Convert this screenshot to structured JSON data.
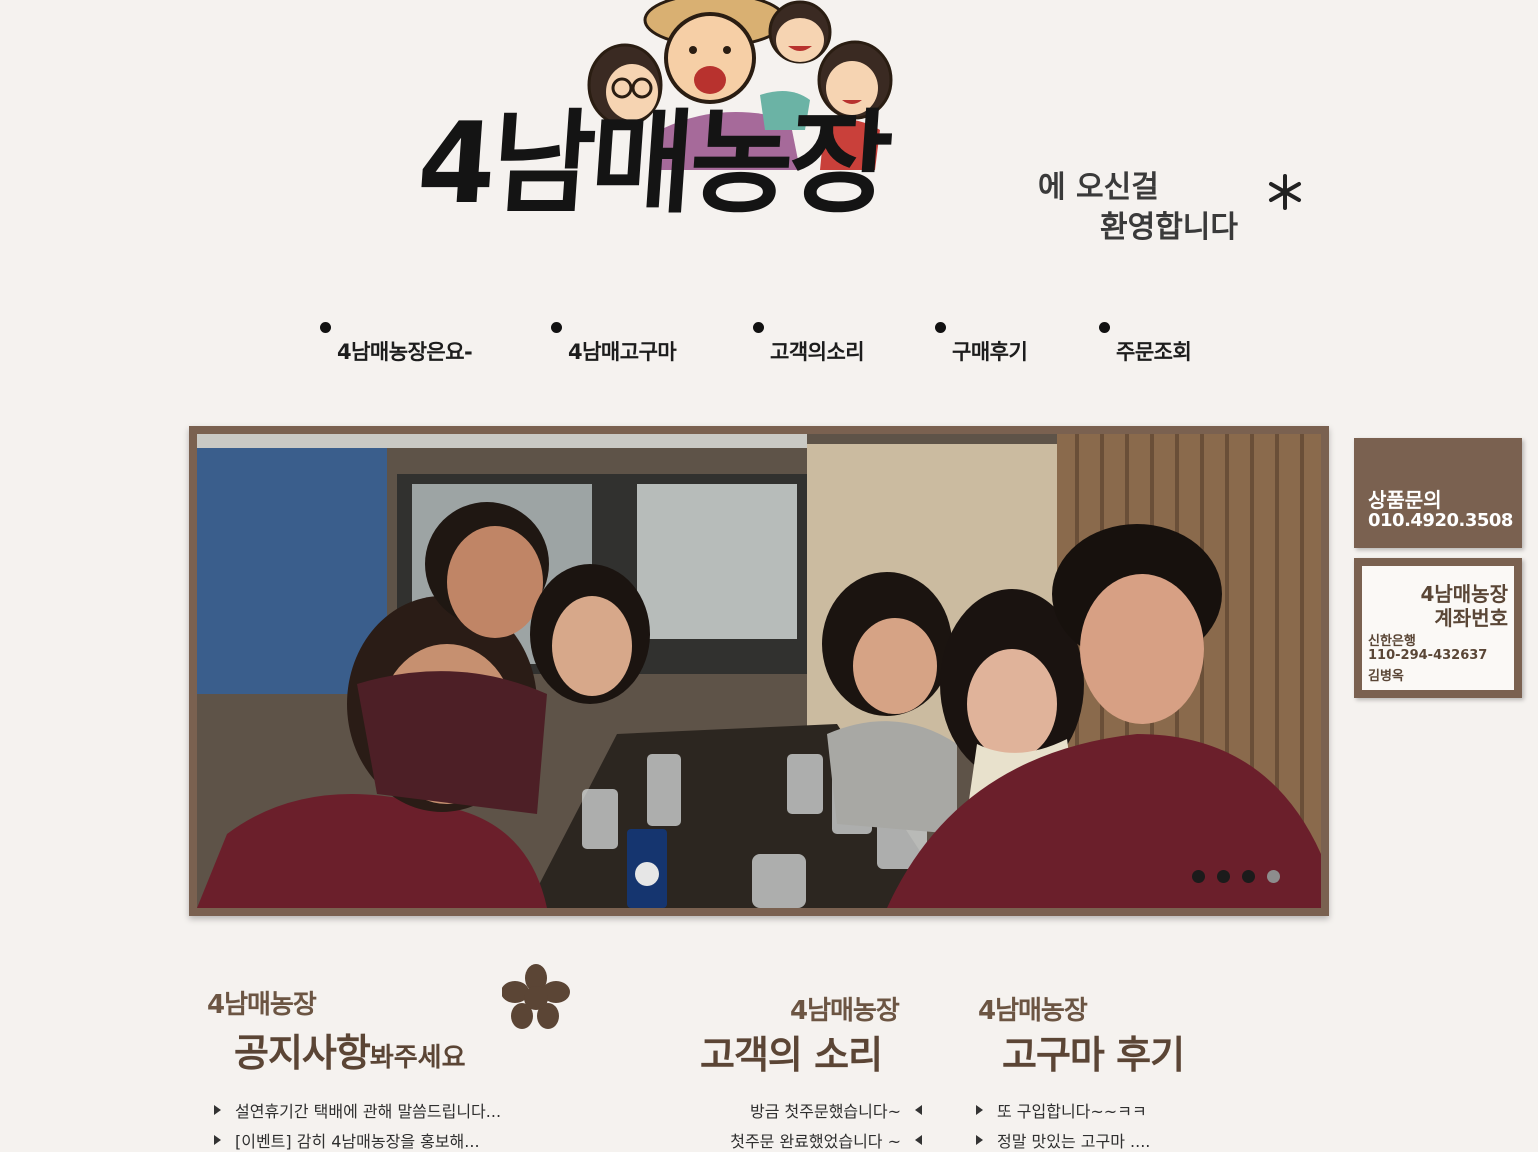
{
  "header": {
    "logo_title": "4남매농장",
    "welcome_line1": "에 오신걸",
    "welcome_line2": "환영합니다"
  },
  "nav": {
    "items": [
      {
        "label": "4남매농장은요-"
      },
      {
        "label": "4남매고구마"
      },
      {
        "label": "고객의소리"
      },
      {
        "label": "구매후기"
      },
      {
        "label": "주문조회"
      }
    ]
  },
  "slideshow": {
    "slide_count": 4,
    "active_slide": 4
  },
  "side": {
    "inquiry_title": "상품문의",
    "inquiry_phone": "010.4920.3508",
    "account_title1": "4남매농장",
    "account_title2": "계좌번호",
    "bank": "신한은행",
    "account_number": "110-294-432637",
    "holder": "김병옥"
  },
  "notice": {
    "small_title": "4남매농장",
    "big_title": "공지사항",
    "suffix": "봐주세요",
    "items": [
      {
        "text": "설연휴기간 택배에 관해 말씀드립니다..."
      },
      {
        "text": "[이벤트] 감히 4남매농장을 홍보해..."
      }
    ]
  },
  "voice": {
    "small_title": "4남매농장",
    "big_title": "고객의 소리",
    "items": [
      {
        "text": "방금 첫주문했습니다~"
      },
      {
        "text": "첫주문 완료했었습니다 ~"
      }
    ]
  },
  "review": {
    "small_title": "4남매농장",
    "big_title": "고구마 후기",
    "items": [
      {
        "text": "또 구입합니다~~ㅋㅋ"
      },
      {
        "text": "정말 맛있는 고구마 ...."
      }
    ]
  },
  "colors": {
    "frame_brown": "#7a6150",
    "background": "#f5f2ef",
    "heading_brown": "#5b4535"
  }
}
